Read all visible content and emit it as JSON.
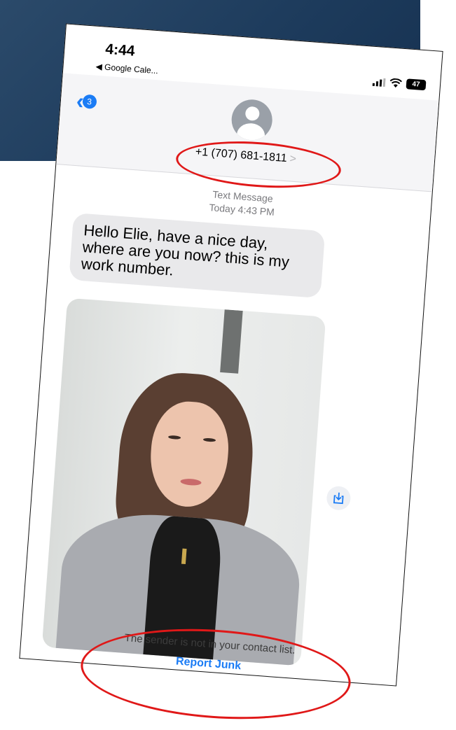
{
  "status_bar": {
    "time": "4:44",
    "back_app": "◀ Google Cale...",
    "battery": "47"
  },
  "header": {
    "back_badge": "3",
    "contact_number": "+1 (707) 681-1811",
    "contact_chevron": ">"
  },
  "conversation": {
    "message_type": "Text Message",
    "timestamp": "Today 4:43 PM",
    "message_text": "Hello Elie, have  a nice day, where are you now? this is my work number.",
    "junk_note": "The sender is not in your contact list.",
    "report_junk_label": "Report Junk"
  },
  "colors": {
    "accent": "#1b7cf5",
    "highlight_circle": "#e01818",
    "bubble": "#e9e9eb"
  },
  "icons": {
    "back": "chevron-left-icon",
    "avatar": "person-icon",
    "save": "download-icon"
  }
}
